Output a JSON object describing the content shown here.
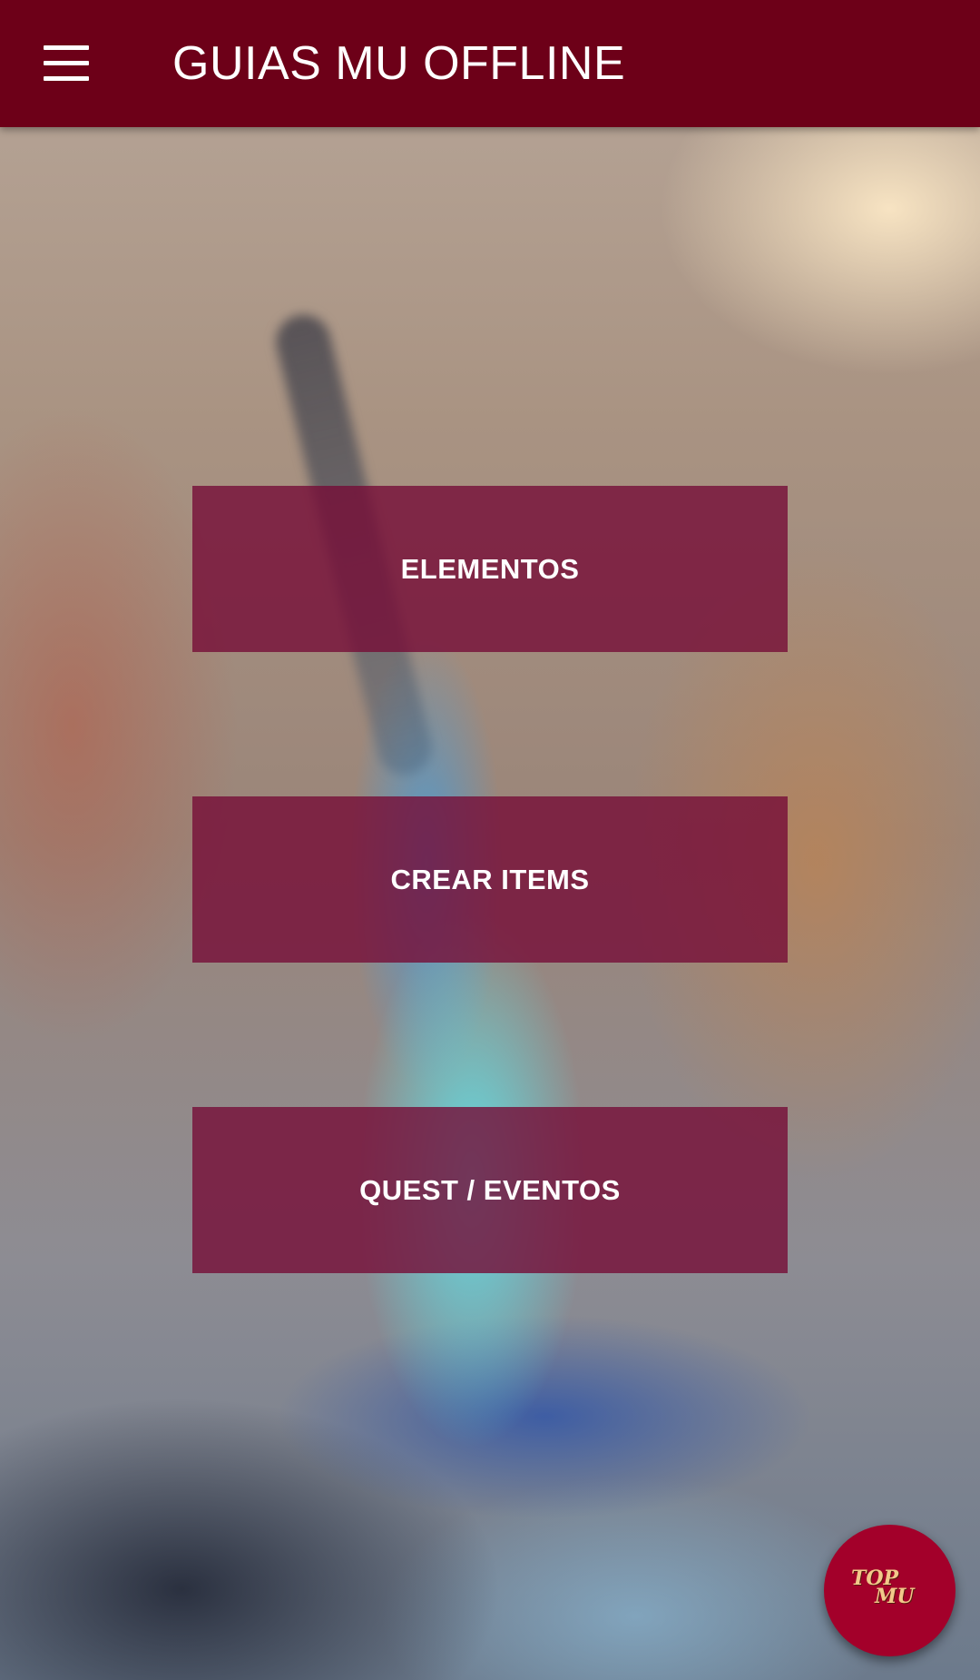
{
  "appbar": {
    "title": "GUIAS MU OFFLINE",
    "menu_icon": "hamburger-menu-icon",
    "color": "#6d0018"
  },
  "main": {
    "buttons": [
      {
        "label": "ELEMENTOS"
      },
      {
        "label": "CREAR ITEMS"
      },
      {
        "label": "QUEST / EVENTOS"
      }
    ],
    "button_color": "#760c37"
  },
  "fab": {
    "logo_line1": "TOP",
    "logo_line2": "MU",
    "color": "#a3002a"
  }
}
